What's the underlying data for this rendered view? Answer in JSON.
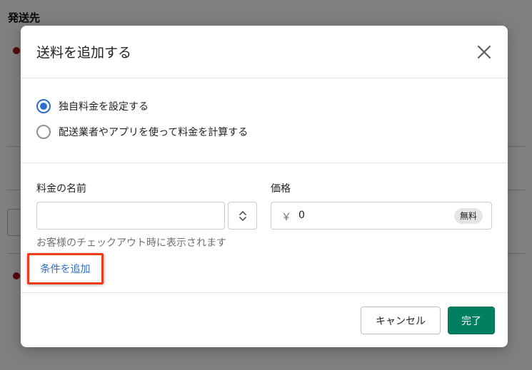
{
  "background": {
    "section_title": "発送先"
  },
  "modal": {
    "title": "送料を追加する",
    "close_icon": "close-icon",
    "options": [
      {
        "label": "独自料金を設定する",
        "selected": true
      },
      {
        "label": "配送業者やアプリを使って料金を計算する",
        "selected": false
      }
    ],
    "rate_name": {
      "label": "料金の名前",
      "value": "",
      "placeholder": "",
      "help": "お客様のチェックアウト時に表示されます"
    },
    "price": {
      "label": "価格",
      "currency": "￥",
      "value": "0",
      "badge": "無料"
    },
    "add_condition": "条件を追加",
    "buttons": {
      "cancel": "キャンセル",
      "done": "完了"
    }
  },
  "colors": {
    "primary": "#008060",
    "link": "#2c6ecb",
    "highlight": "#f03a17"
  }
}
